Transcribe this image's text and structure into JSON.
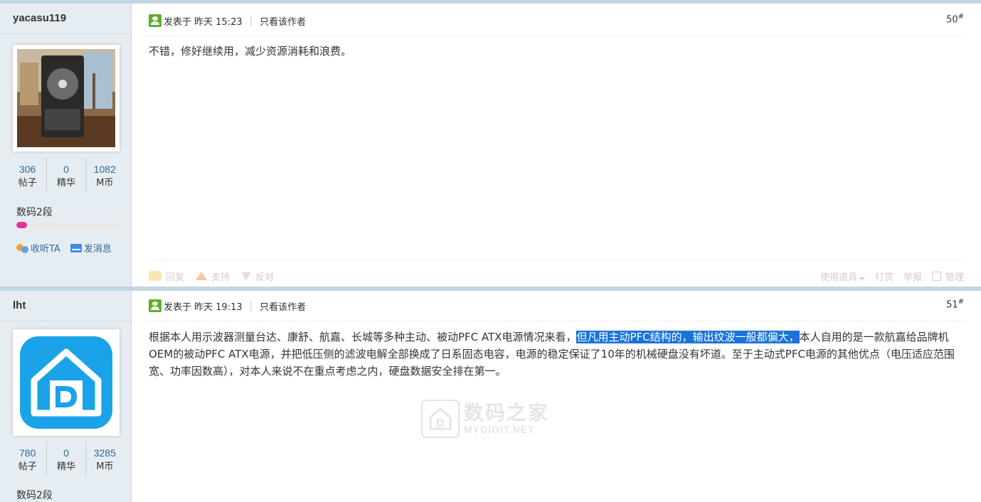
{
  "posts": [
    {
      "username": "yacasu119",
      "stats": [
        {
          "value": "306",
          "label": "帖子"
        },
        {
          "value": "0",
          "label": "精华"
        },
        {
          "value": "1082",
          "label": "M币"
        }
      ],
      "rank": "数码2段",
      "rank_progress": 0.1,
      "follow_label": "收听TA",
      "message_label": "发消息",
      "posted_label": "发表于",
      "posted_time": "昨天 15:23",
      "only_author": "只看该作者",
      "floor": "50",
      "floor_sup": "#",
      "content": "不错，修好继续用，减少资源消耗和浪费。",
      "footer": {
        "reply": "回复",
        "support": "支持",
        "oppose": "反对",
        "tools": "使用道具",
        "tip": "打赏",
        "report": "举报",
        "manage": "管理"
      }
    },
    {
      "username": "lht",
      "stats": [
        {
          "value": "780",
          "label": "帖子"
        },
        {
          "value": "0",
          "label": "精华"
        },
        {
          "value": "3285",
          "label": "M币"
        }
      ],
      "rank": "数码2段",
      "posted_label": "发表于",
      "posted_time": "昨天 19:13",
      "only_author": "只看该作者",
      "floor": "51",
      "floor_sup": "#",
      "content_before": "根据本人用示波器测量台达、康舒、航嘉、长城等多种主动、被动PFC ATX电源情况来看，",
      "content_highlight": "但凡用主动PFC结构的，输出纹波一般都偏大，",
      "content_after": "本人自用的是一款航嘉给品牌机OEM的被动PFC ATX电源，并把低压侧的滤波电解全部换成了日系固态电容，电源的稳定保证了10年的机械硬盘没有坏道。至于主动式PFC电源的其他优点（电压适应范围宽、功率因数高），对本人来说不在重点考虑之内，硬盘数据安全排在第一。"
    }
  ],
  "watermark": {
    "cn": "数码之家",
    "en": "MYDIGIT.NET"
  },
  "colors": {
    "sidebar_bg": "#e5edf2",
    "separator": "#c2d5e3",
    "link": "#336699",
    "highlight": "#1a73d9",
    "rank_bar": "#e0349b"
  }
}
